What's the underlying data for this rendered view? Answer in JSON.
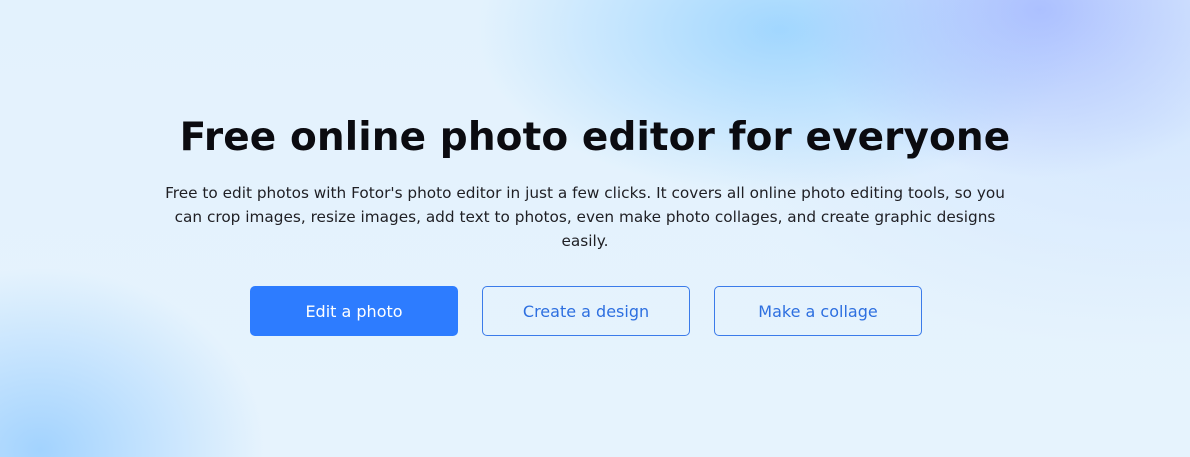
{
  "hero": {
    "title": "Free online photo editor for everyone",
    "description": "Free to edit photos with Fotor's photo editor in just a few clicks. It covers all online photo editing tools, so you can crop images, resize images, add text to photos, even make photo collages, and create graphic designs easily.",
    "buttons": {
      "edit_photo": "Edit a photo",
      "create_design": "Create a design",
      "make_collage": "Make a collage"
    }
  },
  "colors": {
    "primary": "#2d7cff",
    "outline_text": "#2d6fe0",
    "title_text": "#0b0b10",
    "background": "#e3f2fd"
  }
}
